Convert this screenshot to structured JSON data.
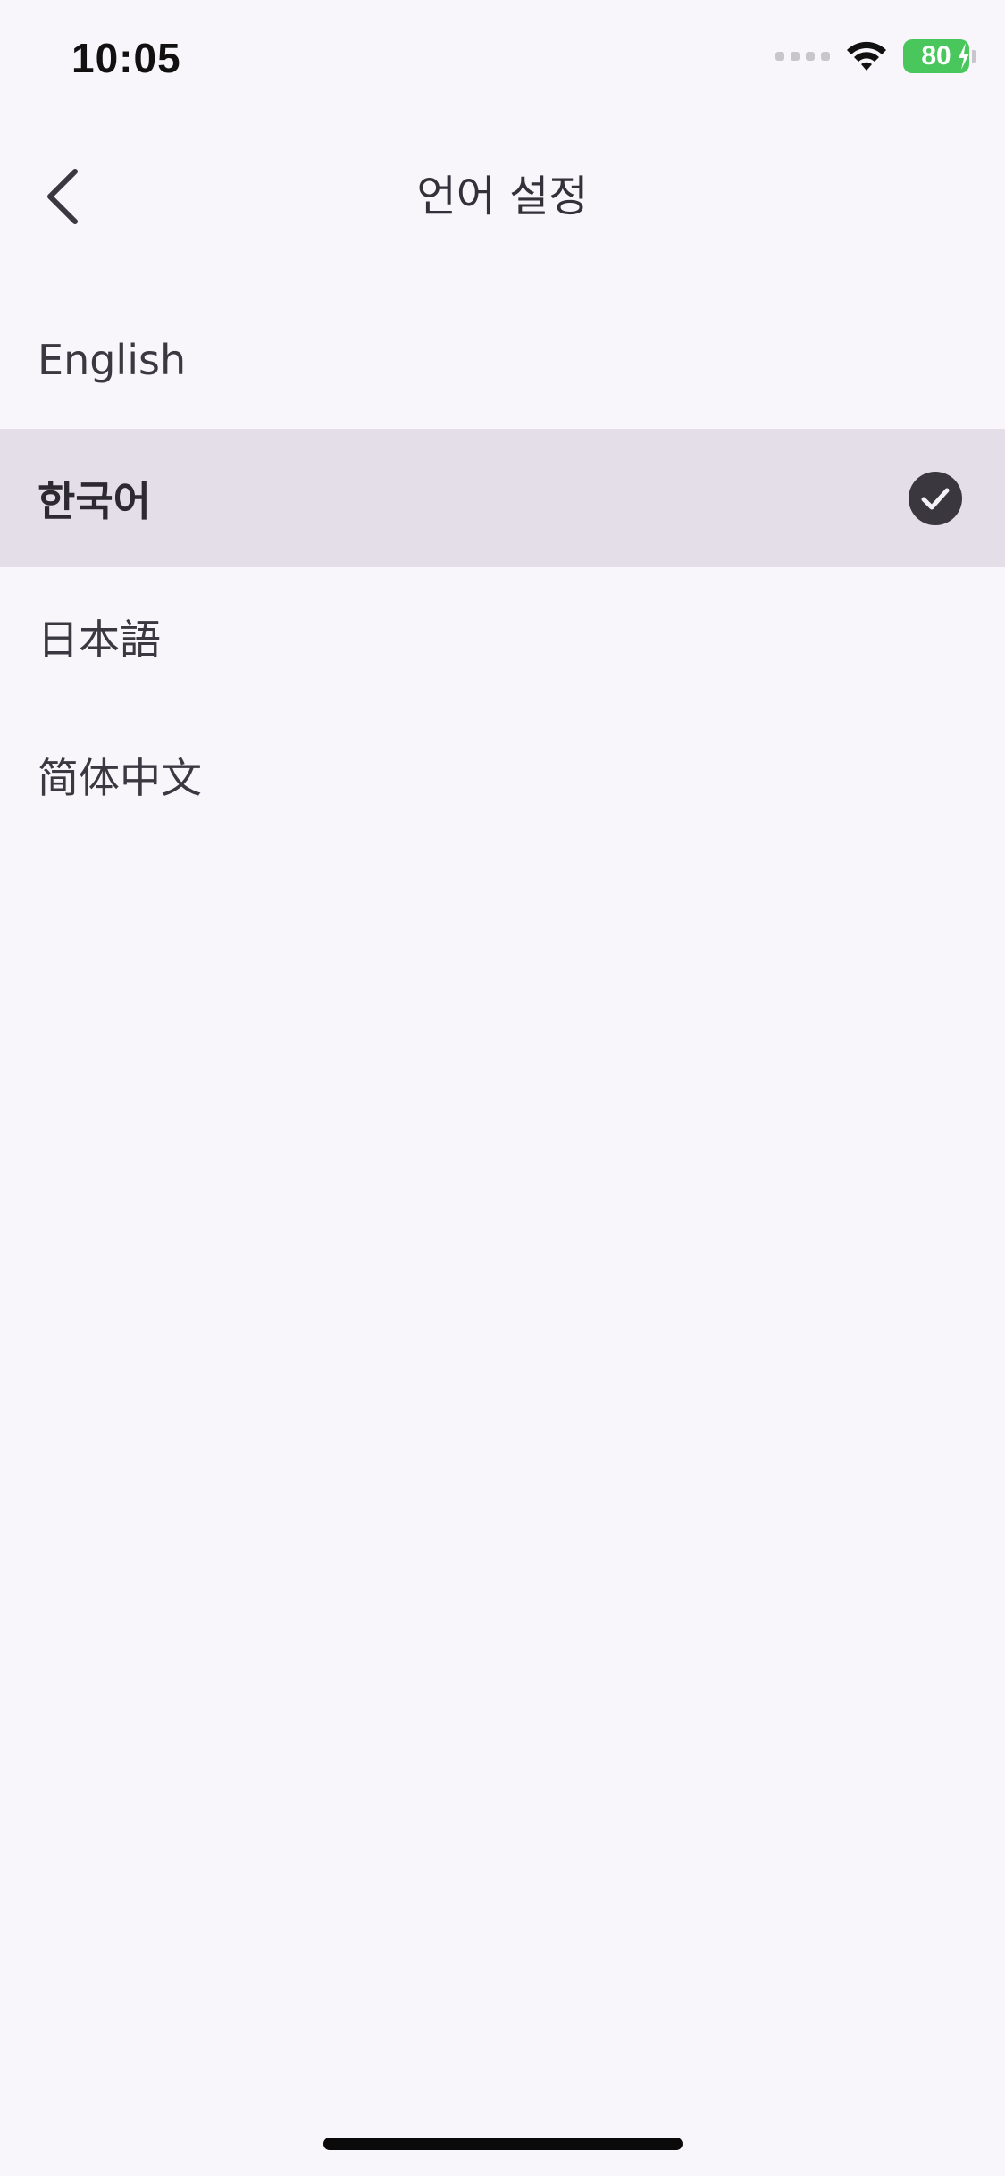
{
  "status_bar": {
    "time": "10:05",
    "battery_level": "80",
    "battery_color": "#49C75C",
    "icons": [
      "signal-dots-icon",
      "wifi-icon",
      "battery-icon",
      "charging-bolt-icon"
    ]
  },
  "header": {
    "title": "언어 설정",
    "back_icon": "chevron-left-icon"
  },
  "languages": {
    "items": [
      {
        "label": "English",
        "selected": false
      },
      {
        "label": "한국어",
        "selected": true
      },
      {
        "label": "日本語",
        "selected": false
      },
      {
        "label": "简体中文",
        "selected": false
      }
    ],
    "selected_icon": "checkmark-circle-icon",
    "selected_background": "#E4DEE8"
  },
  "colors": {
    "background": "#F8F5FB",
    "text": "#3A3840",
    "check_circle": "#3A383E"
  }
}
